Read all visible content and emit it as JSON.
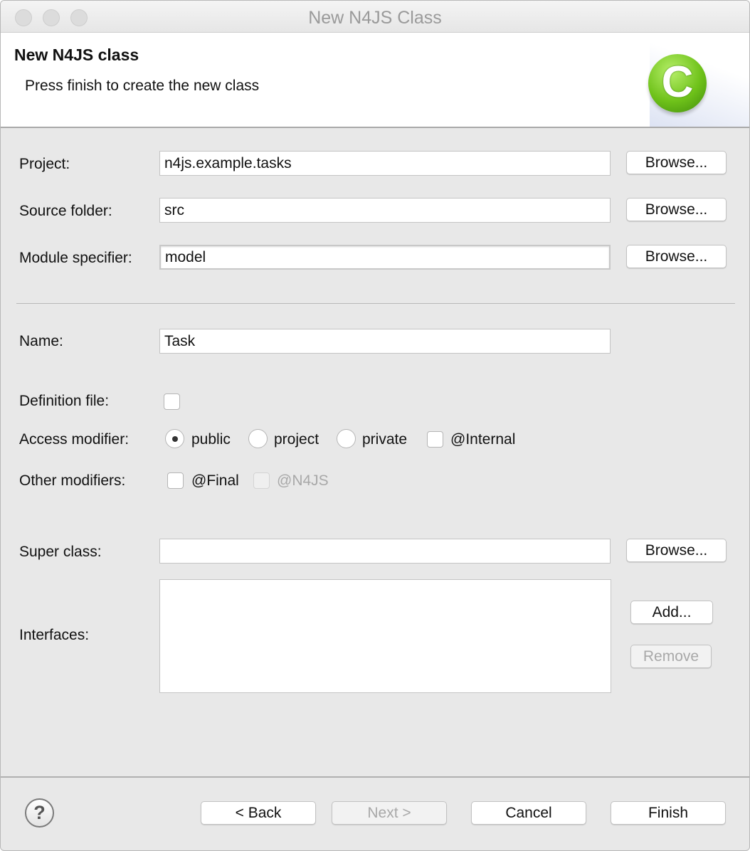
{
  "window": {
    "title": "New N4JS Class"
  },
  "header": {
    "title": "New N4JS class",
    "description": "Press finish to create the new class",
    "logo_letter": "C"
  },
  "fields": {
    "project": {
      "label": "Project:",
      "value": "n4js.example.tasks",
      "browse": "Browse..."
    },
    "source_folder": {
      "label": "Source folder:",
      "value": "src",
      "browse": "Browse..."
    },
    "module_specifier": {
      "label": "Module specifier:",
      "value": "model",
      "browse": "Browse..."
    },
    "name": {
      "label": "Name:",
      "value": "Task"
    },
    "definition_file": {
      "label": "Definition file:",
      "checked": false
    },
    "access_modifier": {
      "label": "Access modifier:",
      "options": [
        "public",
        "project",
        "private"
      ],
      "selected": "public",
      "internal_label": "@Internal",
      "internal_checked": false
    },
    "other_modifiers": {
      "label": "Other modifiers:",
      "final_label": "@Final",
      "final_checked": false,
      "n4js_label": "@N4JS",
      "n4js_enabled": false
    },
    "super_class": {
      "label": "Super class:",
      "value": "",
      "browse": "Browse..."
    },
    "interfaces": {
      "label": "Interfaces:",
      "items": [],
      "add": "Add...",
      "remove": "Remove"
    }
  },
  "footer": {
    "help": "?",
    "back": "< Back",
    "next": "Next >",
    "cancel": "Cancel",
    "finish": "Finish"
  }
}
